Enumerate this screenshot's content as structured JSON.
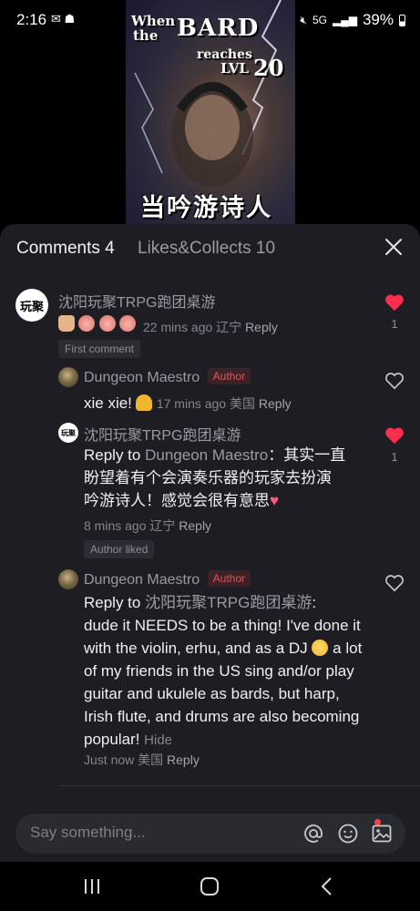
{
  "status_bar": {
    "time": "2:16",
    "left_icons": [
      "gmail-icon",
      "discord-icon"
    ],
    "network": "5G",
    "battery": "39%"
  },
  "video": {
    "caption_when": "When",
    "caption_the": "the",
    "caption_bard": "BARD",
    "caption_reaches": "reaches",
    "caption_lvl": "LVL",
    "caption_lvl_number": "20",
    "caption_cn": "当吟游诗人"
  },
  "sheet": {
    "tab_comments": "Comments 4",
    "tab_likes": "Likes&Collects 10"
  },
  "comments": [
    {
      "name": "沈阳玩聚TRPG跑团桌游",
      "avatar_text": "玩聚",
      "time": "22 mins ago 辽宁",
      "reply": "Reply",
      "chip": "First comment",
      "likes": "1",
      "liked": true
    },
    {
      "name": "Dungeon Maestro",
      "badge": "Author",
      "text": "xie xie!",
      "time": "17 mins ago 美国",
      "reply": "Reply",
      "liked": false
    },
    {
      "name": "沈阳玩聚TRPG跑团桌游",
      "avatar_text": "玩聚",
      "reply_prefix": "Reply to",
      "reply_target": "Dungeon Maestro",
      "text_line1": "：其实一直",
      "text_line2": "盼望着有个会演奏乐器的玩家去扮演",
      "text_line3": "吟游诗人！感觉会很有意思",
      "time": "8 mins ago 辽宁",
      "reply": "Reply",
      "chip": "Author liked",
      "likes": "1",
      "liked": true
    },
    {
      "name": "Dungeon Maestro",
      "badge": "Author",
      "reply_prefix": "Reply to",
      "reply_target": "沈阳玩聚TRPG跑团桌游",
      "line1": ":",
      "line2": "dude it NEEDS to be a thing! I've done it",
      "line3a": "with the violin, erhu, and as a DJ",
      "line3b": "a lot",
      "line4": "of my friends in the US sing and/or play",
      "line5": "guitar and ukulele as bards, but harp,",
      "line6": "Irish flute, and drums are also becoming",
      "line7": "popular!",
      "hide": "Hide",
      "time": "Just now 美国",
      "reply": "Reply",
      "liked": false
    }
  ],
  "input": {
    "placeholder": "Say something..."
  },
  "colors": {
    "sheet_bg": "#1d1d23",
    "like_red": "#ff2e4d",
    "author_badge": "#e25555"
  }
}
